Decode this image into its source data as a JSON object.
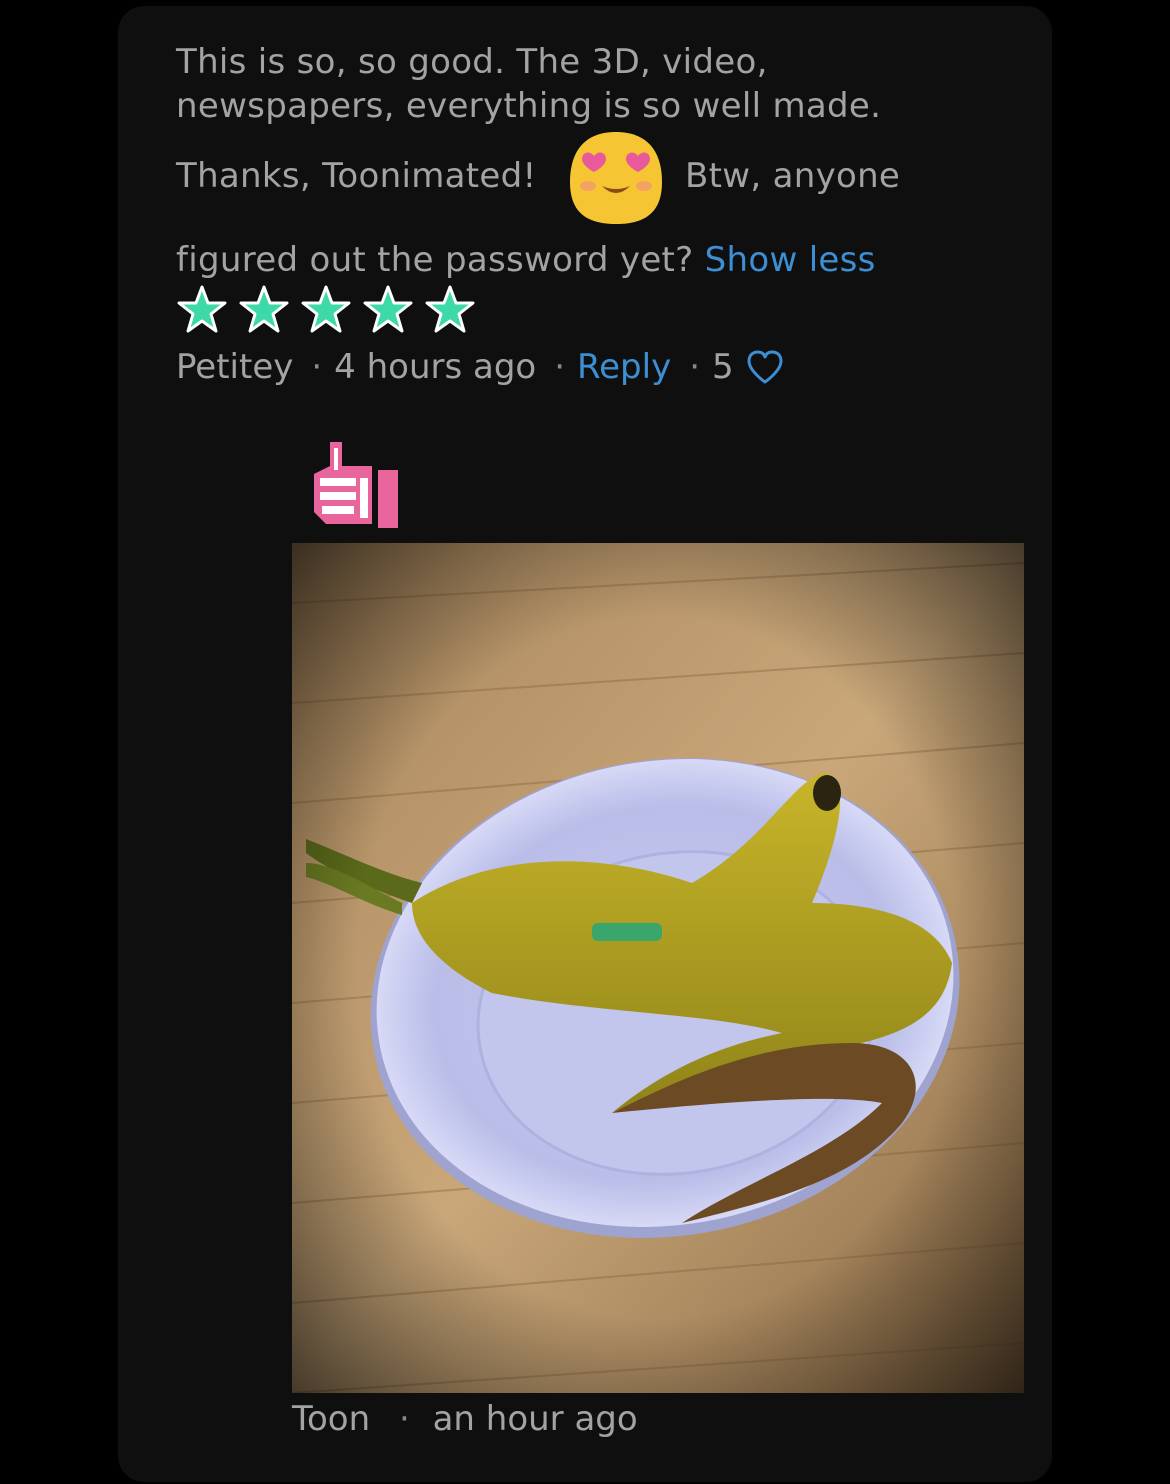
{
  "comment": {
    "text_lines": [
      "This is so, so good. The 3D, video,",
      "newspapers, everything is so well made."
    ],
    "thanks_text": "Thanks, Toonimated!",
    "emoji": "heart-eyes-emoji",
    "after_emoji_text": "Btw, anyone",
    "last_line_text": "figured out the password yet?",
    "show_less_label": "Show less",
    "rating": 5,
    "author": "Petitey",
    "time": "4 hours ago",
    "reply_label": "Reply",
    "likes": "5"
  },
  "reply": {
    "reaction_icon": "thumbs-up-icon",
    "photo": "banana-peel-on-plate-photo",
    "author": "Toon",
    "time": "an hour ago"
  },
  "colors": {
    "background": "#000000",
    "card": "#0f0f0f",
    "text": "#a3a3a3",
    "link": "#3d8fd4",
    "star": "#3dd9a8",
    "thumb": "#e8669b"
  }
}
